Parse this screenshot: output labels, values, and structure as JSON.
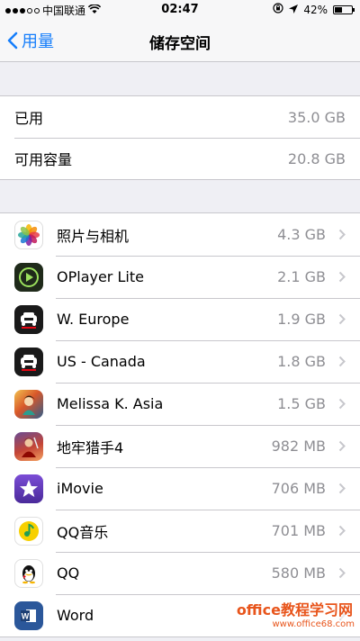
{
  "status_bar": {
    "carrier": "中国联通",
    "time": "02:47",
    "battery": "42%",
    "battery_level": 0.42,
    "signal_icon": "signal-dots-icon",
    "wifi_icon": "wifi-icon",
    "lock_icon": "orientation-lock-icon",
    "location_icon": "location-arrow-icon"
  },
  "nav": {
    "back_label": "用量",
    "title": "储存空间",
    "accent": "#157efb"
  },
  "summary": [
    {
      "label": "已用",
      "value": "35.0 GB"
    },
    {
      "label": "可用容量",
      "value": "20.8 GB"
    }
  ],
  "apps": [
    {
      "name": "照片与相机",
      "size": "4.3 GB",
      "icon": "photos-icon"
    },
    {
      "name": "OPlayer Lite",
      "size": "2.1 GB",
      "icon": "oplayer-icon"
    },
    {
      "name": "W. Europe",
      "size": "1.9 GB",
      "icon": "tomtom-icon"
    },
    {
      "name": "US - Canada",
      "size": "1.8 GB",
      "icon": "tomtom-icon"
    },
    {
      "name": "Melissa K. Asia",
      "size": "1.5 GB",
      "icon": "melissa-game-icon"
    },
    {
      "name": "地牢猎手4",
      "size": "982 MB",
      "icon": "dungeon-hunter-icon"
    },
    {
      "name": "iMovie",
      "size": "706 MB",
      "icon": "imovie-icon"
    },
    {
      "name": "QQ音乐",
      "size": "701 MB",
      "icon": "qq-music-icon"
    },
    {
      "name": "QQ",
      "size": "580 MB",
      "icon": "qq-icon"
    },
    {
      "name": "Word",
      "size": "",
      "icon": "word-icon"
    }
  ],
  "watermark": {
    "title": "office教程学习网",
    "url": "www.office68.com"
  }
}
